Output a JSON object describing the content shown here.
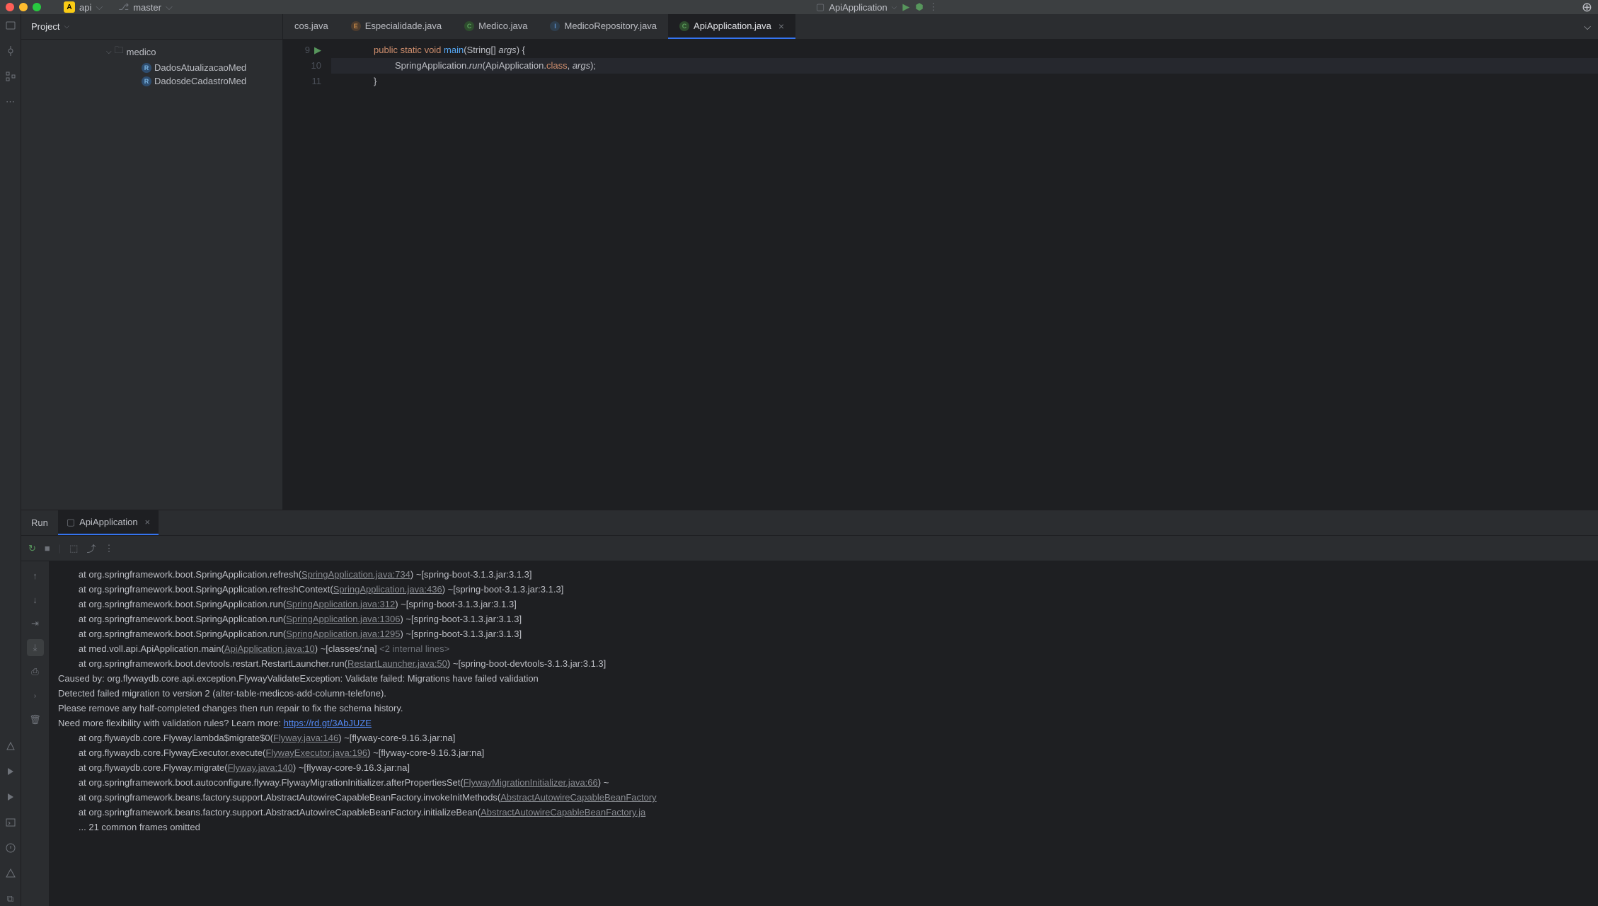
{
  "titlebar": {
    "project_badge": "A",
    "project_name": "api",
    "branch_icon": "⎇",
    "branch": "master",
    "run_config": "ApiApplication"
  },
  "sidebar": {
    "project_label": "Project"
  },
  "tree": {
    "folder": "medico",
    "files": [
      "DadosAtualizacaoMed",
      "DadosdeCadastroMed"
    ]
  },
  "tabs": [
    {
      "icon": "",
      "label": "cos.java",
      "type": ""
    },
    {
      "icon": "E",
      "label": "Especialidade.java",
      "type": "te"
    },
    {
      "icon": "C",
      "label": "Medico.java",
      "type": "tc"
    },
    {
      "icon": "I",
      "label": "MedicoRepository.java",
      "type": "ti"
    },
    {
      "icon": "C",
      "label": "ApiApplication.java",
      "type": "tc",
      "active": true
    }
  ],
  "editor": {
    "lines": [
      "9",
      "10",
      "11"
    ],
    "l9": {
      "kw_public": "public",
      "kw_static": "static",
      "kw_void": "void",
      "mth": "main",
      "par_type": "String[]",
      "par_name": "args"
    },
    "l10": {
      "cls": "SpringApplication",
      "mth": "run",
      "arg1": "ApiApplication",
      "kw_class": "class",
      "arg2": "args"
    },
    "l11": "}"
  },
  "run": {
    "label": "Run",
    "tab": "ApiApplication"
  },
  "console_lines": [
    {
      "pre": "        at org.springframework.boot.SpringApplication.refresh(",
      "link": "SpringApplication.java:734",
      "post": ") ~[spring-boot-3.1.3.jar:3.1.3]"
    },
    {
      "pre": "        at org.springframework.boot.SpringApplication.refreshContext(",
      "link": "SpringApplication.java:436",
      "post": ") ~[spring-boot-3.1.3.jar:3.1.3]"
    },
    {
      "pre": "        at org.springframework.boot.SpringApplication.run(",
      "link": "SpringApplication.java:312",
      "post": ") ~[spring-boot-3.1.3.jar:3.1.3]"
    },
    {
      "pre": "        at org.springframework.boot.SpringApplication.run(",
      "link": "SpringApplication.java:1306",
      "post": ") ~[spring-boot-3.1.3.jar:3.1.3]"
    },
    {
      "pre": "        at org.springframework.boot.SpringApplication.run(",
      "link": "SpringApplication.java:1295",
      "post": ") ~[spring-boot-3.1.3.jar:3.1.3]"
    },
    {
      "pre": "        at med.voll.api.ApiApplication.main(",
      "link": "ApiApplication.java:10",
      "post": ") ~[classes/:na] ",
      "dim": "<2 internal lines>"
    },
    {
      "pre": "        at org.springframework.boot.devtools.restart.RestartLauncher.run(",
      "link": "RestartLauncher.java:50",
      "post": ") ~[spring-boot-devtools-3.1.3.jar:3.1.3]"
    },
    {
      "plain": "Caused by: org.flywaydb.core.api.exception.FlywayValidateException: Validate failed: Migrations have failed validation"
    },
    {
      "plain": "Detected failed migration to version 2 (alter-table-medicos-add-column-telefone)."
    },
    {
      "plain": "Please remove any half-completed changes then run repair to fix the schema history."
    },
    {
      "pre": "Need more flexibility with validation rules? Learn more: ",
      "blink": "https://rd.gt/3AbJUZE"
    },
    {
      "pre": "        at org.flywaydb.core.Flyway.lambda$migrate$0(",
      "link": "Flyway.java:146",
      "post": ") ~[flyway-core-9.16.3.jar:na]"
    },
    {
      "pre": "        at org.flywaydb.core.FlywayExecutor.execute(",
      "link": "FlywayExecutor.java:196",
      "post": ") ~[flyway-core-9.16.3.jar:na]"
    },
    {
      "pre": "        at org.flywaydb.core.Flyway.migrate(",
      "link": "Flyway.java:140",
      "post": ") ~[flyway-core-9.16.3.jar:na]"
    },
    {
      "pre": "        at org.springframework.boot.autoconfigure.flyway.FlywayMigrationInitializer.afterPropertiesSet(",
      "link": "FlywayMigrationInitializer.java:66",
      "post": ") ~"
    },
    {
      "pre": "        at org.springframework.beans.factory.support.AbstractAutowireCapableBeanFactory.invokeInitMethods(",
      "link": "AbstractAutowireCapableBeanFactory",
      "post": ""
    },
    {
      "pre": "        at org.springframework.beans.factory.support.AbstractAutowireCapableBeanFactory.initializeBean(",
      "link": "AbstractAutowireCapableBeanFactory.ja",
      "post": ""
    },
    {
      "plain": "        ... 21 common frames omitted"
    }
  ]
}
